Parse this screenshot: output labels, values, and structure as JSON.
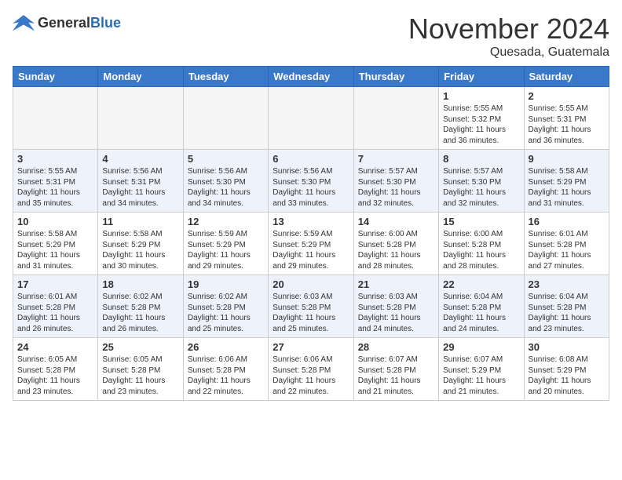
{
  "header": {
    "logo_general": "General",
    "logo_blue": "Blue",
    "month_title": "November 2024",
    "location": "Quesada, Guatemala"
  },
  "days_of_week": [
    "Sunday",
    "Monday",
    "Tuesday",
    "Wednesday",
    "Thursday",
    "Friday",
    "Saturday"
  ],
  "weeks": [
    [
      {
        "day": "",
        "info": ""
      },
      {
        "day": "",
        "info": ""
      },
      {
        "day": "",
        "info": ""
      },
      {
        "day": "",
        "info": ""
      },
      {
        "day": "",
        "info": ""
      },
      {
        "day": "1",
        "info": "Sunrise: 5:55 AM\nSunset: 5:32 PM\nDaylight: 11 hours and 36 minutes."
      },
      {
        "day": "2",
        "info": "Sunrise: 5:55 AM\nSunset: 5:31 PM\nDaylight: 11 hours and 36 minutes."
      }
    ],
    [
      {
        "day": "3",
        "info": "Sunrise: 5:55 AM\nSunset: 5:31 PM\nDaylight: 11 hours and 35 minutes."
      },
      {
        "day": "4",
        "info": "Sunrise: 5:56 AM\nSunset: 5:31 PM\nDaylight: 11 hours and 34 minutes."
      },
      {
        "day": "5",
        "info": "Sunrise: 5:56 AM\nSunset: 5:30 PM\nDaylight: 11 hours and 34 minutes."
      },
      {
        "day": "6",
        "info": "Sunrise: 5:56 AM\nSunset: 5:30 PM\nDaylight: 11 hours and 33 minutes."
      },
      {
        "day": "7",
        "info": "Sunrise: 5:57 AM\nSunset: 5:30 PM\nDaylight: 11 hours and 32 minutes."
      },
      {
        "day": "8",
        "info": "Sunrise: 5:57 AM\nSunset: 5:30 PM\nDaylight: 11 hours and 32 minutes."
      },
      {
        "day": "9",
        "info": "Sunrise: 5:58 AM\nSunset: 5:29 PM\nDaylight: 11 hours and 31 minutes."
      }
    ],
    [
      {
        "day": "10",
        "info": "Sunrise: 5:58 AM\nSunset: 5:29 PM\nDaylight: 11 hours and 31 minutes."
      },
      {
        "day": "11",
        "info": "Sunrise: 5:58 AM\nSunset: 5:29 PM\nDaylight: 11 hours and 30 minutes."
      },
      {
        "day": "12",
        "info": "Sunrise: 5:59 AM\nSunset: 5:29 PM\nDaylight: 11 hours and 29 minutes."
      },
      {
        "day": "13",
        "info": "Sunrise: 5:59 AM\nSunset: 5:29 PM\nDaylight: 11 hours and 29 minutes."
      },
      {
        "day": "14",
        "info": "Sunrise: 6:00 AM\nSunset: 5:28 PM\nDaylight: 11 hours and 28 minutes."
      },
      {
        "day": "15",
        "info": "Sunrise: 6:00 AM\nSunset: 5:28 PM\nDaylight: 11 hours and 28 minutes."
      },
      {
        "day": "16",
        "info": "Sunrise: 6:01 AM\nSunset: 5:28 PM\nDaylight: 11 hours and 27 minutes."
      }
    ],
    [
      {
        "day": "17",
        "info": "Sunrise: 6:01 AM\nSunset: 5:28 PM\nDaylight: 11 hours and 26 minutes."
      },
      {
        "day": "18",
        "info": "Sunrise: 6:02 AM\nSunset: 5:28 PM\nDaylight: 11 hours and 26 minutes."
      },
      {
        "day": "19",
        "info": "Sunrise: 6:02 AM\nSunset: 5:28 PM\nDaylight: 11 hours and 25 minutes."
      },
      {
        "day": "20",
        "info": "Sunrise: 6:03 AM\nSunset: 5:28 PM\nDaylight: 11 hours and 25 minutes."
      },
      {
        "day": "21",
        "info": "Sunrise: 6:03 AM\nSunset: 5:28 PM\nDaylight: 11 hours and 24 minutes."
      },
      {
        "day": "22",
        "info": "Sunrise: 6:04 AM\nSunset: 5:28 PM\nDaylight: 11 hours and 24 minutes."
      },
      {
        "day": "23",
        "info": "Sunrise: 6:04 AM\nSunset: 5:28 PM\nDaylight: 11 hours and 23 minutes."
      }
    ],
    [
      {
        "day": "24",
        "info": "Sunrise: 6:05 AM\nSunset: 5:28 PM\nDaylight: 11 hours and 23 minutes."
      },
      {
        "day": "25",
        "info": "Sunrise: 6:05 AM\nSunset: 5:28 PM\nDaylight: 11 hours and 23 minutes."
      },
      {
        "day": "26",
        "info": "Sunrise: 6:06 AM\nSunset: 5:28 PM\nDaylight: 11 hours and 22 minutes."
      },
      {
        "day": "27",
        "info": "Sunrise: 6:06 AM\nSunset: 5:28 PM\nDaylight: 11 hours and 22 minutes."
      },
      {
        "day": "28",
        "info": "Sunrise: 6:07 AM\nSunset: 5:28 PM\nDaylight: 11 hours and 21 minutes."
      },
      {
        "day": "29",
        "info": "Sunrise: 6:07 AM\nSunset: 5:29 PM\nDaylight: 11 hours and 21 minutes."
      },
      {
        "day": "30",
        "info": "Sunrise: 6:08 AM\nSunset: 5:29 PM\nDaylight: 11 hours and 20 minutes."
      }
    ]
  ]
}
